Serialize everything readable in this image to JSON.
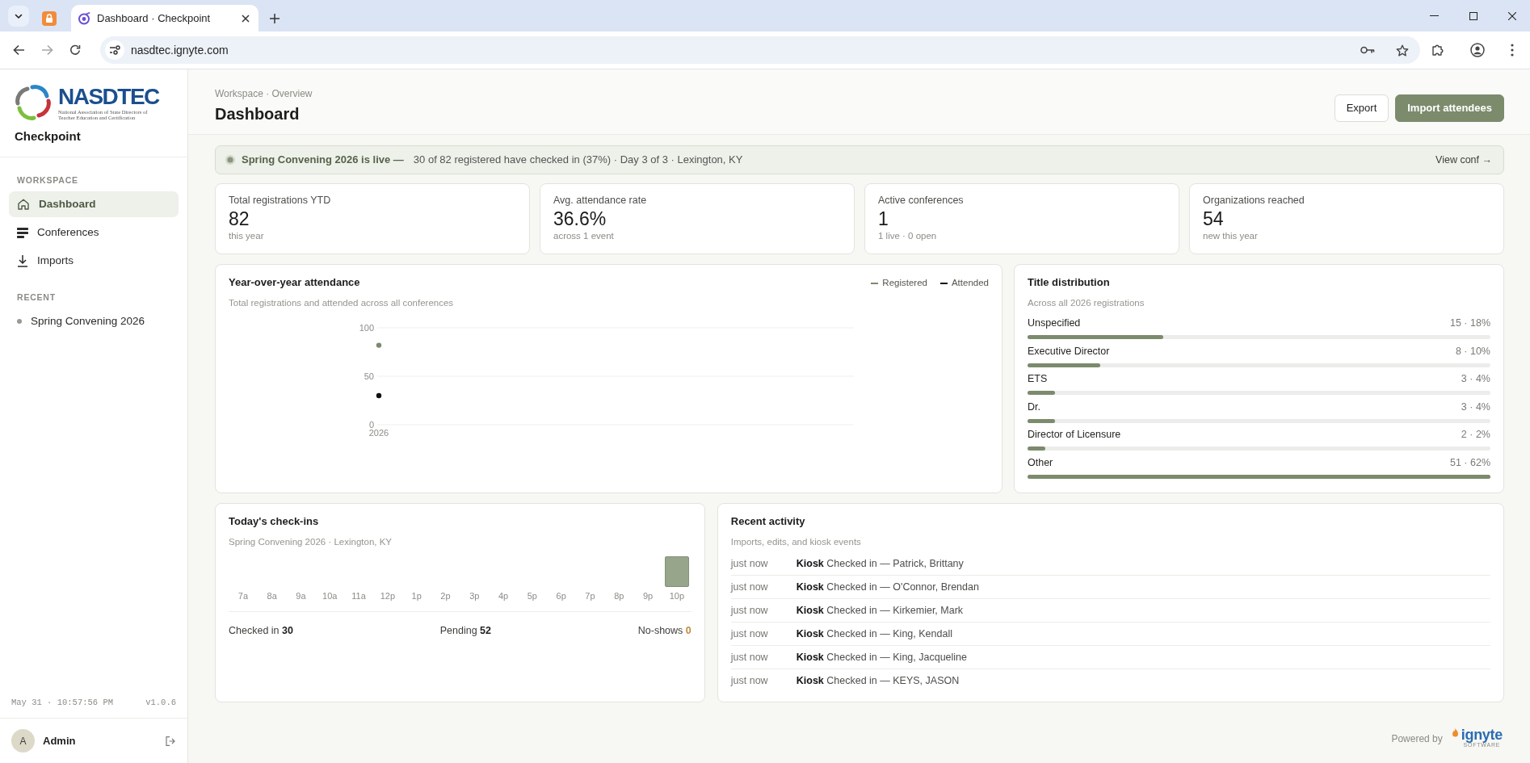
{
  "browser": {
    "tabs": [
      {
        "kind": "pinned",
        "selected": false
      },
      {
        "kind": "page",
        "title": "Dashboard · Checkpoint",
        "selected": true
      }
    ],
    "url": "nasdtec.ignyte.com"
  },
  "sidebar": {
    "logo": {
      "wordmark": "NASDTEC",
      "tagline": "National Association of State Directors of Teacher Education and Certification"
    },
    "app_name": "Checkpoint",
    "sections": [
      {
        "heading": "WORKSPACE",
        "items": [
          {
            "label": "Dashboard",
            "kind": "home",
            "selected": true
          },
          {
            "label": "Conferences",
            "kind": "list",
            "selected": false
          },
          {
            "label": "Imports",
            "kind": "download",
            "selected": false
          }
        ]
      },
      {
        "heading": "RECENT",
        "items": [
          {
            "label": "Spring Convening 2026",
            "kind": "dot",
            "selected": false
          }
        ]
      }
    ],
    "clock": "May 31 · 10:57:56 PM",
    "version": "v1.0.6",
    "user": {
      "initial": "A",
      "name": "Admin"
    }
  },
  "header": {
    "breadcrumb": "Workspace · Overview",
    "title": "Dashboard",
    "buttons": [
      {
        "label": "Export",
        "kind": "secondary"
      },
      {
        "label": "Import attendees",
        "kind": "primary"
      }
    ]
  },
  "banner": {
    "headline": "Spring Convening 2026 is live —",
    "detail": "30 of 82 registered have checked in (37%) · Day 3 of 3 · Lexington, KY",
    "link": "View conf →"
  },
  "stats": [
    {
      "label": "Total registrations YTD",
      "value": "82",
      "note": "this year"
    },
    {
      "label": "Avg. attendance rate",
      "value": "36.6%",
      "note": "across 1 event"
    },
    {
      "label": "Active conferences",
      "value": "1",
      "note": "1 live · 0 open"
    },
    {
      "label": "Organizations reached",
      "value": "54",
      "note": "new this year"
    }
  ],
  "attendance_chart": {
    "title": "Year-over-year attendance",
    "subtitle": "Total registrations and attended across all conferences",
    "chart_data": {
      "type": "line",
      "categories": [
        "2026"
      ],
      "series": [
        {
          "name": "Registered",
          "color": "#7d8a6d",
          "marker": "circle",
          "values": [
            82
          ]
        },
        {
          "name": "Attended",
          "color": "#111111",
          "marker": "circle",
          "values": [
            30
          ]
        }
      ],
      "ylim": [
        0,
        100
      ],
      "yticks": [
        0,
        50,
        100
      ],
      "legend": "top-right"
    }
  },
  "title_distribution": {
    "title": "Title distribution",
    "subtitle": "Across all 2026 registrations",
    "rows": [
      {
        "label": "Unspecified",
        "reading": "15 · 18%",
        "level": 0.294
      },
      {
        "label": "Executive Director",
        "reading": "8 · 10%",
        "level": 0.157
      },
      {
        "label": "ETS",
        "reading": "3 · 4%",
        "level": 0.059
      },
      {
        "label": "Dr.",
        "reading": "3 · 4%",
        "level": 0.059
      },
      {
        "label": "Director of Licensure",
        "reading": "2 · 2%",
        "level": 0.039
      },
      {
        "label": "Other",
        "reading": "51 · 62%",
        "level": 1
      }
    ]
  },
  "checkins": {
    "title": "Today's check-ins",
    "subtitle": "Spring Convening 2026 · Lexington, KY",
    "hours": [
      "7a",
      "8a",
      "9a",
      "10a",
      "11a",
      "12p",
      "1p",
      "2p",
      "3p",
      "4p",
      "5p",
      "6p",
      "7p",
      "8p",
      "9p",
      "10p"
    ],
    "totals": [
      {
        "label": "Checked in",
        "value": "30",
        "kind": "plain"
      },
      {
        "label": "Pending",
        "value": "52",
        "kind": "plain"
      },
      {
        "label": "No-shows",
        "value": "0",
        "kind": "warning"
      }
    ]
  },
  "activity": {
    "title": "Recent activity",
    "subtitle": "Imports, edits, and kiosk events",
    "rows": [
      {
        "time": "just now",
        "text": "**Kiosk** Checked in — Patrick, Brittany"
      },
      {
        "time": "just now",
        "text": "**Kiosk** Checked in — O'Connor, Brendan"
      },
      {
        "time": "just now",
        "text": "**Kiosk** Checked in — Kirkemier, Mark"
      },
      {
        "time": "just now",
        "text": "**Kiosk** Checked in — King, Kendall"
      },
      {
        "time": "just now",
        "text": "**Kiosk** Checked in — King, Jacqueline"
      },
      {
        "time": "just now",
        "text": "**Kiosk** Checked in — KEYS, JASON"
      }
    ]
  },
  "footer": {
    "label": "Powered by",
    "brand": "ignyte",
    "brand_tagline": "SOFTWARE"
  }
}
